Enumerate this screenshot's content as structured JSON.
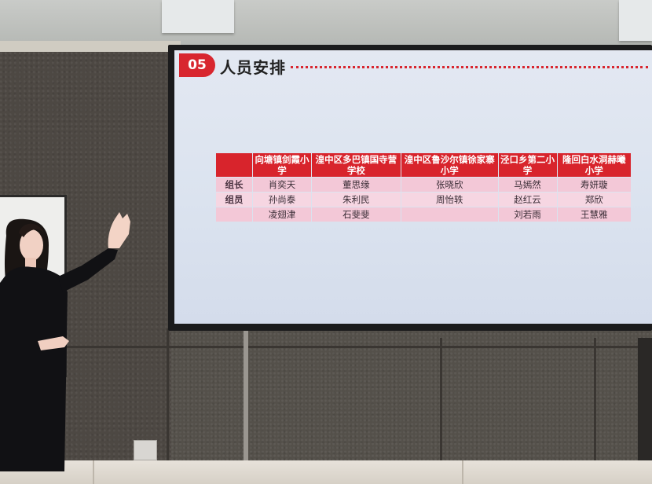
{
  "slide": {
    "number": "05",
    "title": "人员安排"
  },
  "table": {
    "columns": [
      "向塘镇剑霞小学",
      "湟中区多巴镇国寺营学校",
      "湟中区鲁沙尔镇徐家寨小学",
      "泾口乡第二小学",
      "隆回白水洞赫曦小学"
    ],
    "rows": [
      {
        "role": "组长",
        "cells": [
          "肖奕天",
          "董思缘",
          "张晓欣",
          "马嫣然",
          "寿妍璇"
        ]
      },
      {
        "role": "组员",
        "cells": [
          "孙尚泰",
          "朱利民",
          "周怡轶",
          "赵红云",
          "郑欣"
        ]
      },
      {
        "role": "",
        "cells": [
          "凌翅津",
          "石斐斐",
          "",
          "刘若雨",
          "王慧雅"
        ]
      }
    ]
  },
  "colors": {
    "accent_red": "#d8242c",
    "row_pink": "#f3c8d7",
    "screen_bg": "#dbe3ef"
  }
}
